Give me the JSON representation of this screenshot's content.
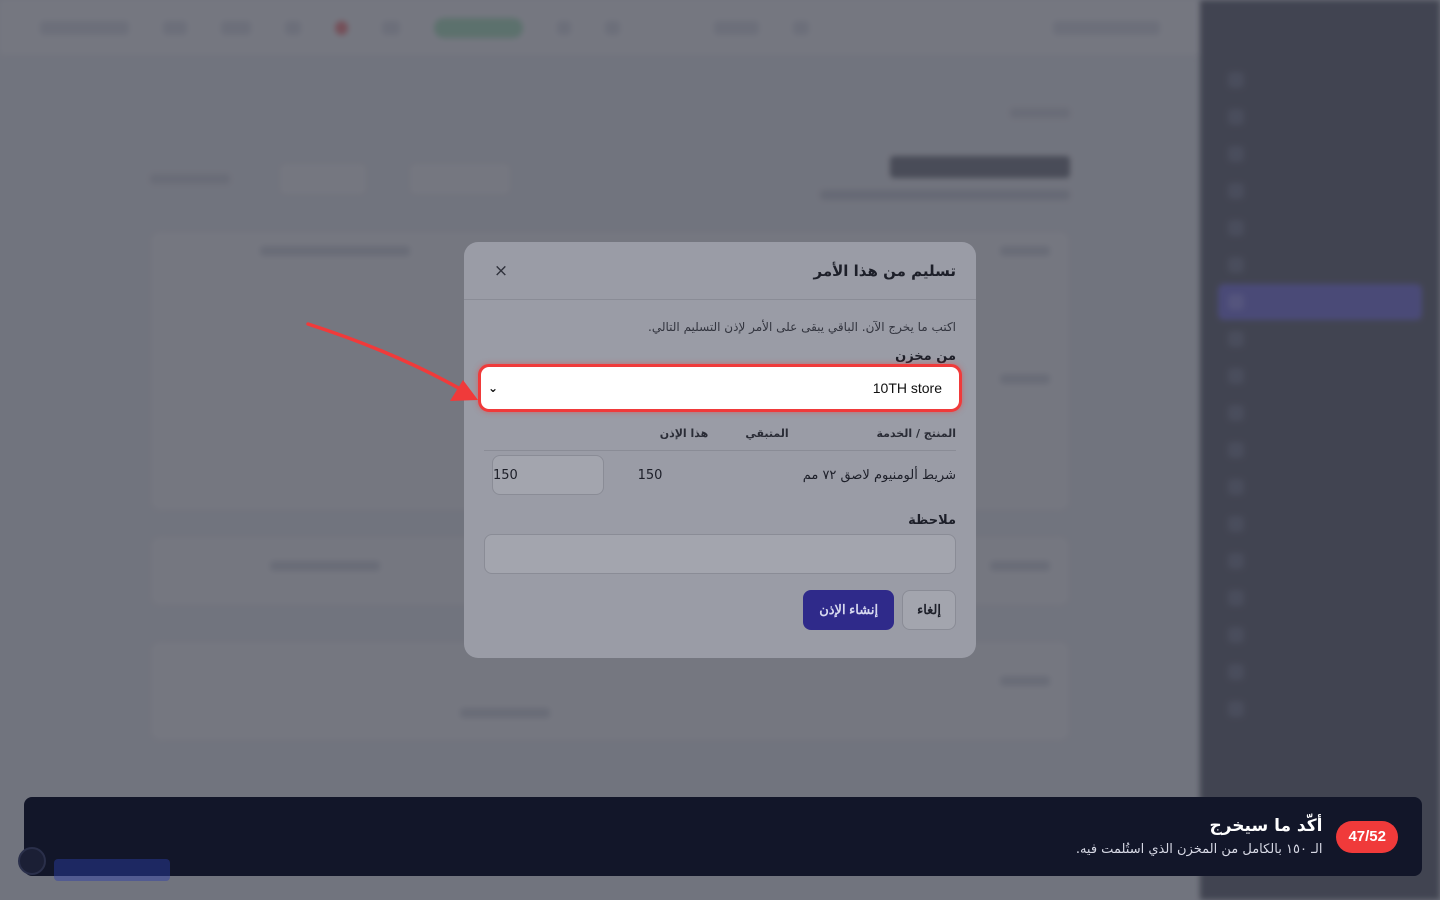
{
  "modal": {
    "title": "تسليم من هذا الأمر",
    "close_icon": "close-icon",
    "hint": "اكتب ما يخرج الآن. الباقي يبقى على الأمر لإذن التسليم التالي.",
    "warehouse_label": "من مخزن",
    "warehouse_value": "10TH store",
    "table": {
      "headers": {
        "product": "المنتج / الخدمة",
        "remaining": "المتبقي",
        "this_permit": "هذا الإذن"
      },
      "rows": [
        {
          "product": "شريط ألومنيوم لاصق ٧٢ مم",
          "remaining": "150",
          "qty": "150"
        }
      ]
    },
    "note_label": "ملاحظة",
    "note_value": "",
    "create_button": "إنشاء الإذن",
    "cancel_button": "إلغاء"
  },
  "toast": {
    "badge": "47/52",
    "title": "أكّد ما سيخرج",
    "body": "الـ ١٥٠ بالكامل من المخزن الذي استُلمت فيه."
  },
  "colors": {
    "highlight": "#f03a3a",
    "primary": "#2f2a8a",
    "toast_bg": "#121629"
  }
}
